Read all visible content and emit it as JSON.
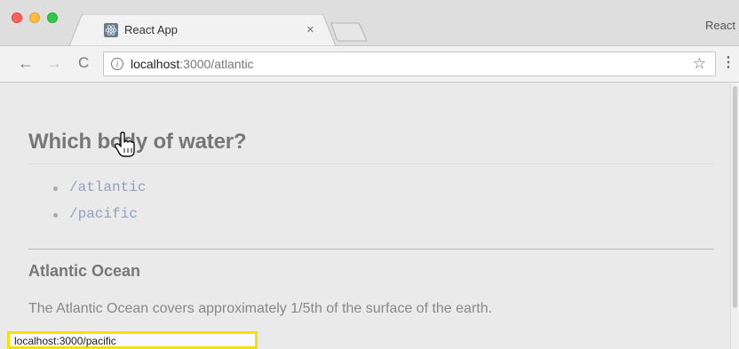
{
  "browser": {
    "tab_title": "React App",
    "tab_close": "×",
    "profile_label": "React",
    "back_icon": "←",
    "forward_icon": "→",
    "reload_icon": "C",
    "url_host": "localhost",
    "url_rest": ":3000/atlantic",
    "star_icon": "☆",
    "menu_icon": "⋮"
  },
  "page": {
    "heading": "Which body of water?",
    "links": [
      {
        "label": "/atlantic"
      },
      {
        "label": "/pacific"
      }
    ],
    "section_title": "Atlantic Ocean",
    "description": "The Atlantic Ocean covers approximately 1/5th of the surface of the earth."
  },
  "status_bar": {
    "url": "localhost:3000/pacific"
  },
  "colors": {
    "link": "#8ea1bd",
    "status_highlight": "#f5e00c"
  }
}
